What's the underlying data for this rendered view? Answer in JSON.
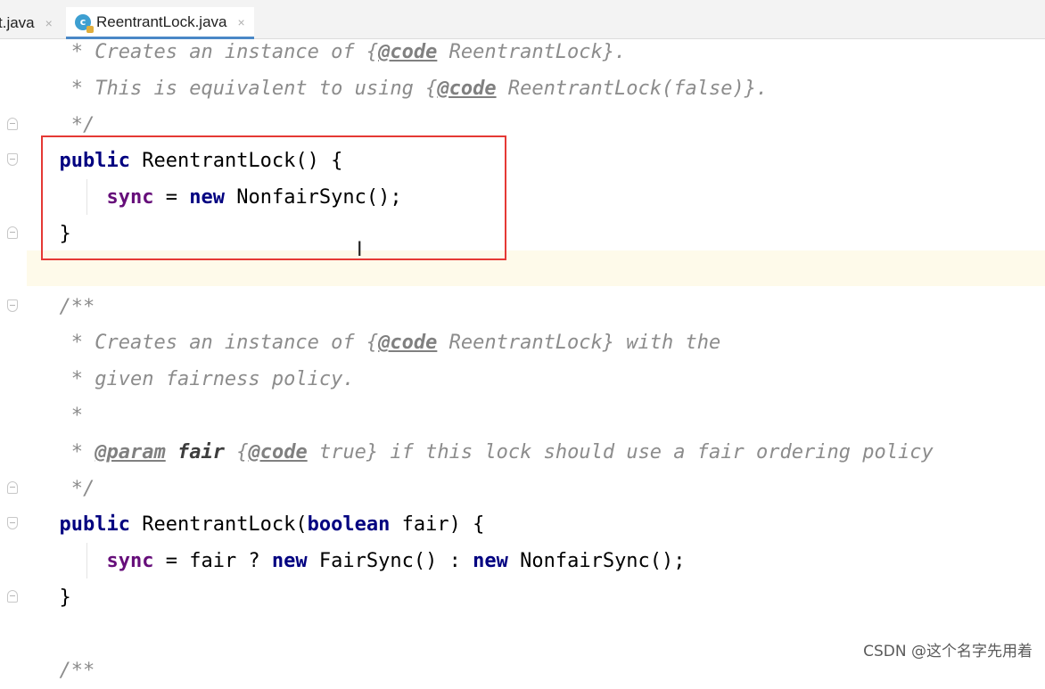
{
  "tabs": [
    {
      "label": "t.java",
      "close": "×"
    },
    {
      "label": "ReentrantLock.java",
      "close": "×",
      "icon": "java-class-icon",
      "icon_letter": "c"
    }
  ],
  "code": [
    {
      "indent": "   ",
      "tokens": [
        [
          "doc",
          "* Creates an instance of {"
        ],
        [
          "tag",
          "@code"
        ],
        [
          "doc",
          " ReentrantLock}."
        ]
      ]
    },
    {
      "indent": "   ",
      "tokens": [
        [
          "doc",
          "* This is equivalent to using {"
        ],
        [
          "tag",
          "@code"
        ],
        [
          "doc",
          " ReentrantLock(false)}."
        ]
      ]
    },
    {
      "indent": "   ",
      "tokens": [
        [
          "doc",
          "*/"
        ]
      ]
    },
    {
      "indent": "  ",
      "tokens": [
        [
          "kw",
          "public"
        ],
        [
          "plain",
          " ReentrantLock() {"
        ]
      ]
    },
    {
      "indent": "      ",
      "tokens": [
        [
          "fld",
          "sync"
        ],
        [
          "plain",
          " = "
        ],
        [
          "kw",
          "new"
        ],
        [
          "plain",
          " NonfairSync();"
        ]
      ]
    },
    {
      "indent": "  ",
      "tokens": [
        [
          "plain",
          "}"
        ]
      ]
    },
    {
      "indent": "",
      "tokens": []
    },
    {
      "indent": "  ",
      "tokens": [
        [
          "doc",
          "/**"
        ]
      ]
    },
    {
      "indent": "   ",
      "tokens": [
        [
          "doc",
          "* Creates an instance of {"
        ],
        [
          "tag",
          "@code"
        ],
        [
          "doc",
          " ReentrantLock} with the"
        ]
      ]
    },
    {
      "indent": "   ",
      "tokens": [
        [
          "doc",
          "* given fairness policy."
        ]
      ]
    },
    {
      "indent": "   ",
      "tokens": [
        [
          "doc",
          "*"
        ]
      ]
    },
    {
      "indent": "   ",
      "tokens": [
        [
          "doc",
          "* "
        ],
        [
          "tag",
          "@param"
        ],
        [
          "doc",
          " "
        ],
        [
          "pm",
          "fair"
        ],
        [
          "doc",
          " {"
        ],
        [
          "tag",
          "@code"
        ],
        [
          "doc",
          " true} if this lock should use a fair ordering policy"
        ]
      ]
    },
    {
      "indent": "   ",
      "tokens": [
        [
          "doc",
          "*/"
        ]
      ]
    },
    {
      "indent": "  ",
      "tokens": [
        [
          "kw",
          "public"
        ],
        [
          "plain",
          " ReentrantLock("
        ],
        [
          "kw",
          "boolean"
        ],
        [
          "plain",
          " fair) {"
        ]
      ]
    },
    {
      "indent": "      ",
      "tokens": [
        [
          "fld",
          "sync"
        ],
        [
          "plain",
          " = fair ? "
        ],
        [
          "kw",
          "new"
        ],
        [
          "plain",
          " FairSync() : "
        ],
        [
          "kw",
          "new"
        ],
        [
          "plain",
          " NonfairSync();"
        ]
      ]
    },
    {
      "indent": "  ",
      "tokens": [
        [
          "plain",
          "}"
        ]
      ]
    },
    {
      "indent": "",
      "tokens": []
    },
    {
      "indent": "  ",
      "tokens": [
        [
          "doc",
          "/**"
        ]
      ]
    }
  ],
  "watermark": "CSDN @这个名字先用着",
  "colors": {
    "keyword": "#000080",
    "field": "#660e7a",
    "comment": "#8c8c8c",
    "highlight_box": "#e53935",
    "caret_line": "#fefaea"
  }
}
